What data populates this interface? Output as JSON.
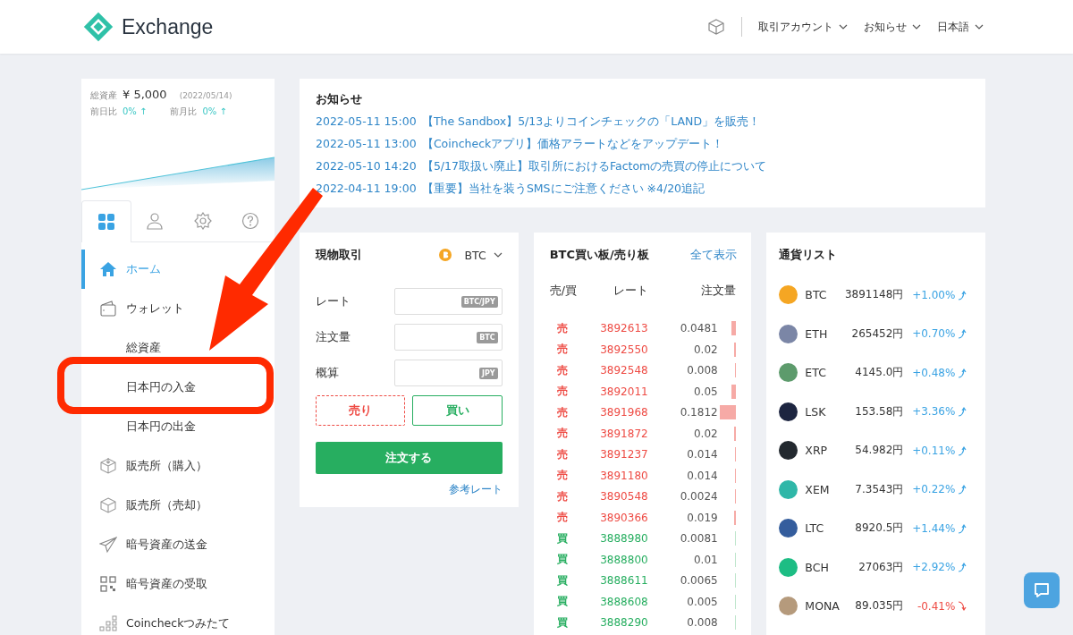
{
  "header": {
    "logo": "Exchange",
    "menus": [
      "取引アカウント",
      "お知らせ",
      "日本語"
    ]
  },
  "summary": {
    "label": "総資産",
    "amount": "¥ 5,000",
    "date": "(2022/05/14)",
    "day_label": "前日比",
    "day_change": "0% ↑",
    "month_label": "前月比",
    "month_change": "0% ↑"
  },
  "tabs": [
    {
      "kind": "grid",
      "selected": true
    },
    {
      "kind": "user",
      "selected": false
    },
    {
      "kind": "gear",
      "selected": false
    },
    {
      "kind": "help",
      "selected": false
    }
  ],
  "sidebar": {
    "items": [
      {
        "label": "ホーム",
        "kind": "home",
        "selected": true
      },
      {
        "label": "ウォレット",
        "kind": "wallet",
        "selected": false
      },
      {
        "label": "総資産",
        "kind": "sub",
        "selected": false
      },
      {
        "label": "日本円の入金",
        "kind": "sub",
        "selected": false
      },
      {
        "label": "日本円の出金",
        "kind": "sub",
        "selected": false
      },
      {
        "label": "販売所（購入）",
        "kind": "buy",
        "selected": false
      },
      {
        "label": "販売所（売却）",
        "kind": "sell",
        "selected": false
      },
      {
        "label": "暗号資産の送金",
        "kind": "send",
        "selected": false
      },
      {
        "label": "暗号資産の受取",
        "kind": "receive",
        "selected": false
      },
      {
        "label": "Coincheckつみたて",
        "kind": "stack",
        "selected": false
      }
    ]
  },
  "notices": {
    "title": "お知らせ",
    "items": [
      {
        "time": "2022-05-11 15:00",
        "text": "【The Sandbox】5/13よりコインチェックの「LAND」を販売！"
      },
      {
        "time": "2022-05-11 13:00",
        "text": "【Coincheckアプリ】価格アラートなどをアップデート！"
      },
      {
        "time": "2022-05-10 14:20",
        "text": "【5/17取扱い廃止】取引所におけるFactomの売買の停止について"
      },
      {
        "time": "2022-04-11 19:00",
        "text": "【重要】当社を装うSMSにご注意ください ※4/20追記"
      }
    ]
  },
  "spot": {
    "title": "現物取引",
    "currency": "BTC",
    "fields": [
      {
        "label": "レート",
        "unit": "BTC/JPY"
      },
      {
        "label": "注文量",
        "unit": "BTC"
      },
      {
        "label": "概算",
        "unit": "JPY"
      }
    ],
    "sides": [
      {
        "label": "売り",
        "kind": "sell",
        "selected": false
      },
      {
        "label": "買い",
        "kind": "buy",
        "selected": false
      }
    ],
    "submit": "注文する",
    "link": "参考レート"
  },
  "orderbook": {
    "title": "BTC買い板/売り板",
    "link": "全て表示",
    "columns": [
      "売/買",
      "レート",
      "注文量"
    ],
    "rows": [
      {
        "side": "売",
        "kind": "sell",
        "rate": "3892613",
        "amount": "0.0481"
      },
      {
        "side": "売",
        "kind": "sell",
        "rate": "3892550",
        "amount": "0.02"
      },
      {
        "side": "売",
        "kind": "sell",
        "rate": "3892548",
        "amount": "0.008"
      },
      {
        "side": "売",
        "kind": "sell",
        "rate": "3892011",
        "amount": "0.05"
      },
      {
        "side": "売",
        "kind": "sell",
        "rate": "3891968",
        "amount": "0.1812"
      },
      {
        "side": "売",
        "kind": "sell",
        "rate": "3891872",
        "amount": "0.02"
      },
      {
        "side": "売",
        "kind": "sell",
        "rate": "3891237",
        "amount": "0.014"
      },
      {
        "side": "売",
        "kind": "sell",
        "rate": "3891180",
        "amount": "0.014"
      },
      {
        "side": "売",
        "kind": "sell",
        "rate": "3890548",
        "amount": "0.0024"
      },
      {
        "side": "売",
        "kind": "sell",
        "rate": "3890366",
        "amount": "0.019"
      },
      {
        "side": "買",
        "kind": "buy",
        "rate": "3888980",
        "amount": "0.0081"
      },
      {
        "side": "買",
        "kind": "buy",
        "rate": "3888800",
        "amount": "0.01"
      },
      {
        "side": "買",
        "kind": "buy",
        "rate": "3888611",
        "amount": "0.0065"
      },
      {
        "side": "買",
        "kind": "buy",
        "rate": "3888608",
        "amount": "0.005"
      },
      {
        "side": "買",
        "kind": "buy",
        "rate": "3888290",
        "amount": "0.008"
      }
    ]
  },
  "currencies": {
    "title": "通貨リスト",
    "items": [
      {
        "symbol": "BTC",
        "price": "3891148円",
        "change": "+1.00%",
        "kind": "up",
        "color": "#f5a623"
      },
      {
        "symbol": "ETH",
        "price": "265452円",
        "change": "+0.70%",
        "kind": "up",
        "color": "#7b86a6"
      },
      {
        "symbol": "ETC",
        "price": "4145.0円",
        "change": "+0.48%",
        "kind": "up",
        "color": "#5d9b6c"
      },
      {
        "symbol": "LSK",
        "price": "153.58円",
        "change": "+3.36%",
        "kind": "up",
        "color": "#1d2540"
      },
      {
        "symbol": "XRP",
        "price": "54.982円",
        "change": "+0.11%",
        "kind": "up",
        "color": "#23292f"
      },
      {
        "symbol": "XEM",
        "price": "7.3543円",
        "change": "+0.22%",
        "kind": "up",
        "color": "#2fb7a8"
      },
      {
        "symbol": "LTC",
        "price": "8920.5円",
        "change": "+1.44%",
        "kind": "up",
        "color": "#345d9d"
      },
      {
        "symbol": "BCH",
        "price": "27063円",
        "change": "+2.92%",
        "kind": "up",
        "color": "#1dbd84"
      },
      {
        "symbol": "MONA",
        "price": "89.035円",
        "change": "-0.41%",
        "kind": "down",
        "color": "#b59a7c"
      }
    ]
  }
}
